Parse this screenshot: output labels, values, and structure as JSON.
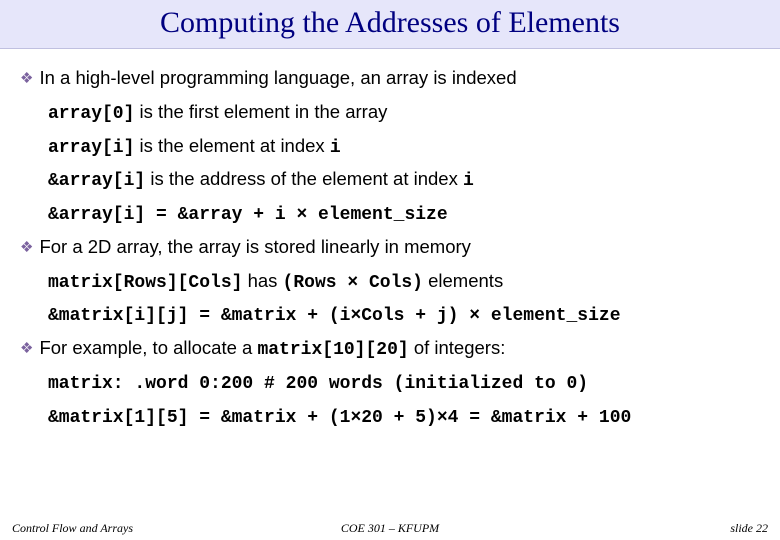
{
  "title": "Computing the Addresses of Elements",
  "bullets": [
    {
      "text": "In a high-level programming language, an array is indexed",
      "subs": [
        {
          "segments": [
            {
              "t": "array[0]",
              "mono": true
            },
            {
              "t": " is the first element in the array",
              "mono": false
            }
          ]
        },
        {
          "segments": [
            {
              "t": "array[i]",
              "mono": true
            },
            {
              "t": " is the element at index ",
              "mono": false
            },
            {
              "t": "i",
              "mono": true
            }
          ]
        },
        {
          "segments": [
            {
              "t": "&array[i]",
              "mono": true
            },
            {
              "t": " is the address of the element at index ",
              "mono": false
            },
            {
              "t": "i",
              "mono": true
            }
          ]
        },
        {
          "segments": [
            {
              "t": "&array[i] = &array + i × element_size",
              "mono": true
            }
          ]
        }
      ]
    },
    {
      "text": "For a 2D array, the array is stored linearly in memory",
      "subs": [
        {
          "segments": [
            {
              "t": "matrix[Rows][Cols]",
              "mono": true
            },
            {
              "t": " has ",
              "mono": false
            },
            {
              "t": "(Rows × Cols)",
              "mono": true
            },
            {
              "t": " elements",
              "mono": false
            }
          ]
        },
        {
          "segments": [
            {
              "t": "&matrix[i][j] = &matrix + (i×Cols + j) × element_size",
              "mono": true
            }
          ]
        }
      ]
    },
    {
      "segments": [
        {
          "t": "For example, to allocate a ",
          "mono": false
        },
        {
          "t": "matrix[10][20]",
          "mono": true
        },
        {
          "t": " of integers:",
          "mono": false
        }
      ],
      "subs": [
        {
          "segments": [
            {
              "t": "matrix: .word 0:200 # 200 words (initialized to 0)",
              "mono": true
            }
          ]
        },
        {
          "segments": [
            {
              "t": "&matrix[1][5] = &matrix + (1×20 + 5)×4 = &matrix + 100",
              "mono": true
            }
          ]
        }
      ]
    }
  ],
  "footer": {
    "left": "Control Flow and Arrays",
    "center": "COE 301 – KFUPM",
    "right": "slide 22"
  }
}
